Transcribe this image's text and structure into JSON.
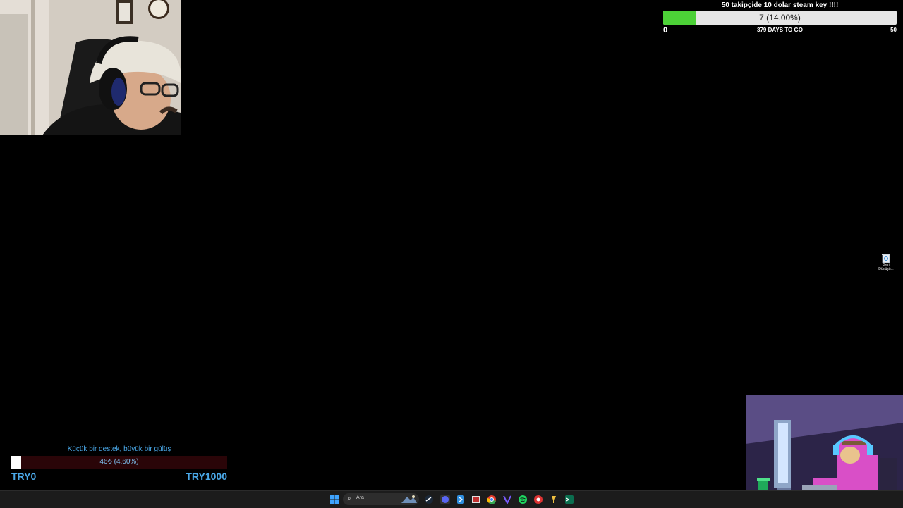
{
  "follower_goal": {
    "title": "50 takipçide 10 dolar steam key !!!!",
    "progress_text": "7 (14.00%)",
    "progress_percent": 14,
    "min_label": "0",
    "days_label": "379 DAYS TO GO",
    "max_label": "50"
  },
  "donation_goal": {
    "title": "Küçük bir destek, büyük bir gülüş",
    "progress_text": "46₺ (4.60%)",
    "progress_percent": 4.6,
    "min_label": "TRY0",
    "max_label": "TRY1000"
  },
  "desktop": {
    "recycle_bin_label": "Geri Dönüşü..."
  },
  "taskbar": {
    "search_placeholder": "Ara",
    "icons": [
      "windows-start-icon",
      "search-icon",
      "steam-icon",
      "discord-icon",
      "app-icon",
      "file-icon",
      "chrome-icon",
      "vpn-icon",
      "spotify-icon",
      "media-icon",
      "tool-icon",
      "terminal-icon"
    ]
  },
  "colors": {
    "follower_fill": "#4cd137",
    "donation_text": "#4aa8e8",
    "donation_bar_bg": "#2a0508"
  }
}
